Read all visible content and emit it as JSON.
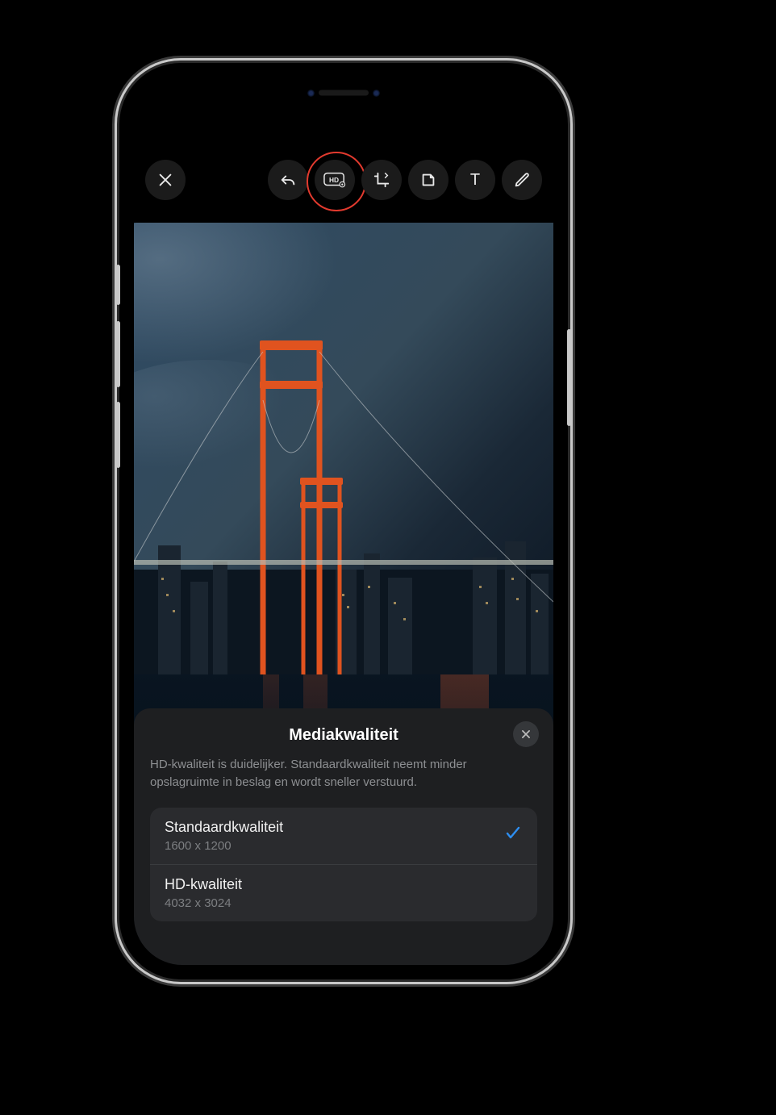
{
  "toolbar": {
    "close_icon": "close",
    "undo_icon": "undo",
    "hd_icon": "hd-settings",
    "crop_icon": "crop-rotate",
    "sticker_icon": "sticker",
    "text_icon_label": "T",
    "draw_icon": "pencil"
  },
  "sheet": {
    "title": "Mediakwaliteit",
    "close_icon": "close",
    "description": "HD-kwaliteit is duidelijker. Standaardkwaliteit neemt minder opslagruimte in beslag en wordt sneller verstuurd.",
    "options": [
      {
        "title": "Standaardkwaliteit",
        "sub": "1600 x 1200",
        "selected": true
      },
      {
        "title": "HD-kwaliteit",
        "sub": "4032 x 3024",
        "selected": false
      }
    ]
  }
}
